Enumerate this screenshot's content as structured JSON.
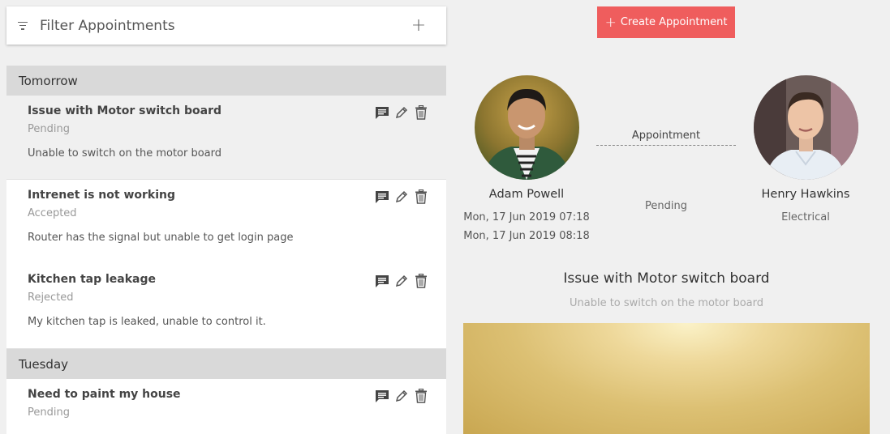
{
  "filter": {
    "title": "Filter Appointments",
    "add_label": "+"
  },
  "groups": [
    {
      "label": "Tomorrow"
    },
    {
      "label": "Tuesday"
    }
  ],
  "appointments": [
    {
      "title": "Issue with Motor switch board",
      "status": "Pending",
      "description": "Unable to switch on the motor board"
    },
    {
      "title": "Intrenet is not working",
      "status": "Accepted",
      "description": "Router has the signal but unable to get login page"
    },
    {
      "title": "Kitchen tap leakage",
      "status": "Rejected",
      "description": "My kitchen tap is leaked, unable to control it."
    },
    {
      "title": "Need to paint my house",
      "status": "Pending",
      "description": ""
    }
  ],
  "create_button": {
    "plus": "+",
    "label": "Create Appointment"
  },
  "detail": {
    "connector_label": "Appointment",
    "status": "Pending",
    "customer": {
      "name": "Adam Powell",
      "start": "Mon, 17 Jun 2019 07:18",
      "end": "Mon, 17 Jun 2019 08:18"
    },
    "provider": {
      "name": "Henry Hawkins",
      "category": "Electrical"
    },
    "title": "Issue with Motor switch board",
    "description": "Unable to switch on the motor board"
  },
  "colors": {
    "accent": "#ef5d5d",
    "group_header": "#d9d9d9",
    "background": "#f0f0f0"
  }
}
